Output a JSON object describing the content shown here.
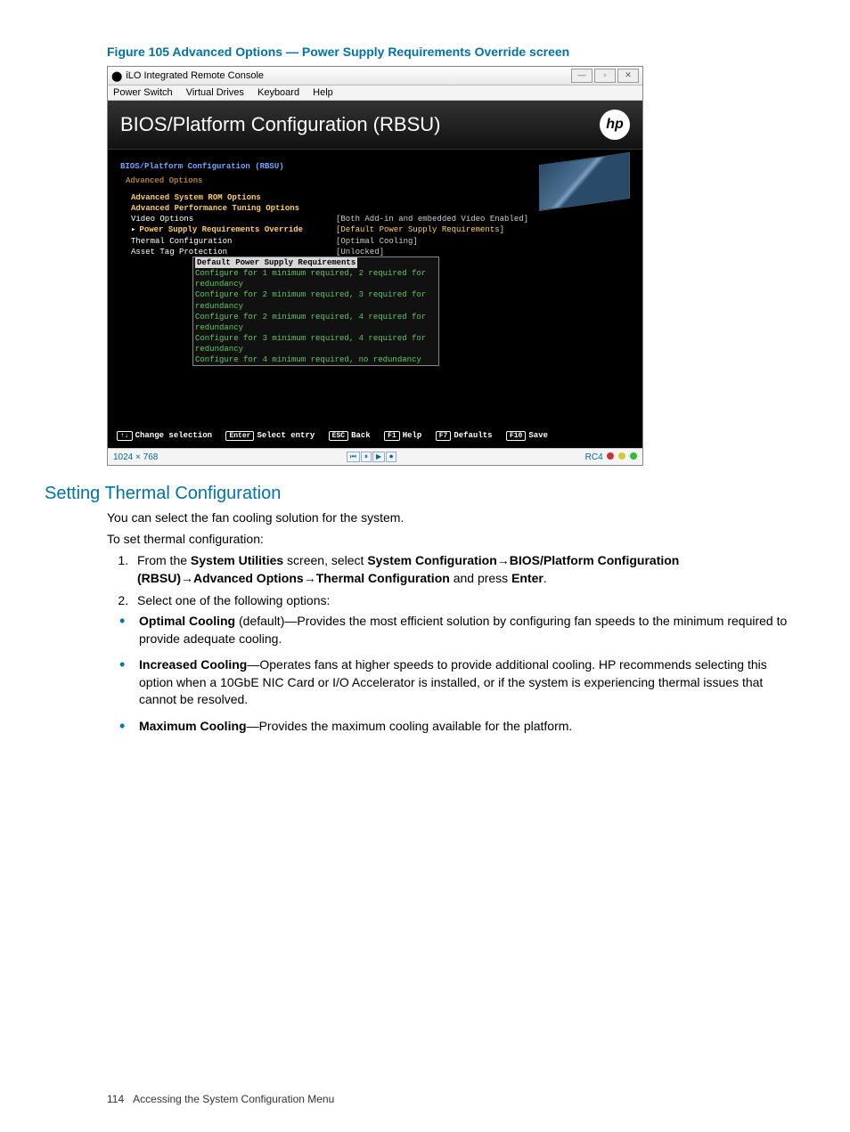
{
  "figure_caption": "Figure 105 Advanced Options — Power Supply Requirements Override screen",
  "window": {
    "title": "iLO Integrated Remote Console",
    "menus": [
      "Power Switch",
      "Virtual Drives",
      "Keyboard",
      "Help"
    ],
    "min": "—",
    "max": "▫",
    "close": "✕"
  },
  "bios": {
    "title": "BIOS/Platform Configuration (RBSU)",
    "logo": "hp",
    "crumb_root": "BIOS/Platform Configuration (RBSU)",
    "crumb_sub": "Advanced Options",
    "options": [
      {
        "label": "Advanced System ROM Options",
        "value": ""
      },
      {
        "label": "Advanced Performance Tuning Options",
        "value": ""
      },
      {
        "label": "Video Options",
        "value": "[Both Add-in and embedded Video Enabled]",
        "plain": true
      },
      {
        "label": "Power Supply Requirements Override",
        "value": "[Default Power Supply Requirements]",
        "selected": true
      },
      {
        "label": "Thermal Configuration",
        "value": "[Optimal Cooling]",
        "plain": true
      },
      {
        "label": "Asset Tag Protection",
        "value": "[Unlocked]",
        "plain": true
      }
    ],
    "popup": {
      "highlight": "Default Power Supply Requirements",
      "lines": [
        "Configure for 1 minimum required, 2 required for redundancy",
        "Configure for 2 minimum required, 3 required for redundancy",
        "Configure for 2 minimum required, 4 required for redundancy",
        "Configure for 3 minimum required, 4 required for redundancy",
        "Configure for 4 minimum required, no redundancy"
      ]
    },
    "keys": [
      {
        "k": "↑↓",
        "t": "Change selection"
      },
      {
        "k": "Enter",
        "t": "Select entry"
      },
      {
        "k": "ESC",
        "t": "Back"
      },
      {
        "k": "F1",
        "t": "Help"
      },
      {
        "k": "F7",
        "t": "Defaults"
      },
      {
        "k": "F10",
        "t": "Save"
      }
    ]
  },
  "status": {
    "res": "1024 × 768",
    "rc": "RC4"
  },
  "section_title": "Setting Thermal Configuration",
  "p1": "You can select the fan cooling solution for the system.",
  "p2": "To set thermal configuration:",
  "step1_a": "From the ",
  "step1_b": "System Utilities",
  "step1_c": " screen, select ",
  "step1_d": "System Configuration",
  "step1_e": "BIOS/Platform Configuration (RBSU)",
  "step1_f": "Advanced Options",
  "step1_g": "Thermal Configuration",
  "step1_h": " and press ",
  "step1_i": "Enter",
  "step1_j": ".",
  "step2": "Select one of the following options:",
  "b1_a": "Optimal Cooling",
  "b1_b": " (default)—Provides the most efficient solution by configuring fan speeds to the minimum required to provide adequate cooling.",
  "b2_a": "Increased Cooling",
  "b2_b": "—Operates fans at higher speeds to provide additional cooling. HP recommends selecting this option when a 10GbE NIC Card or I/O Accelerator is installed, or if the system is experiencing thermal issues that cannot be resolved.",
  "b3_a": "Maximum Cooling",
  "b3_b": "—Provides the maximum cooling available for the platform.",
  "footer_page": "114",
  "footer_text": "Accessing the System Configuration Menu"
}
